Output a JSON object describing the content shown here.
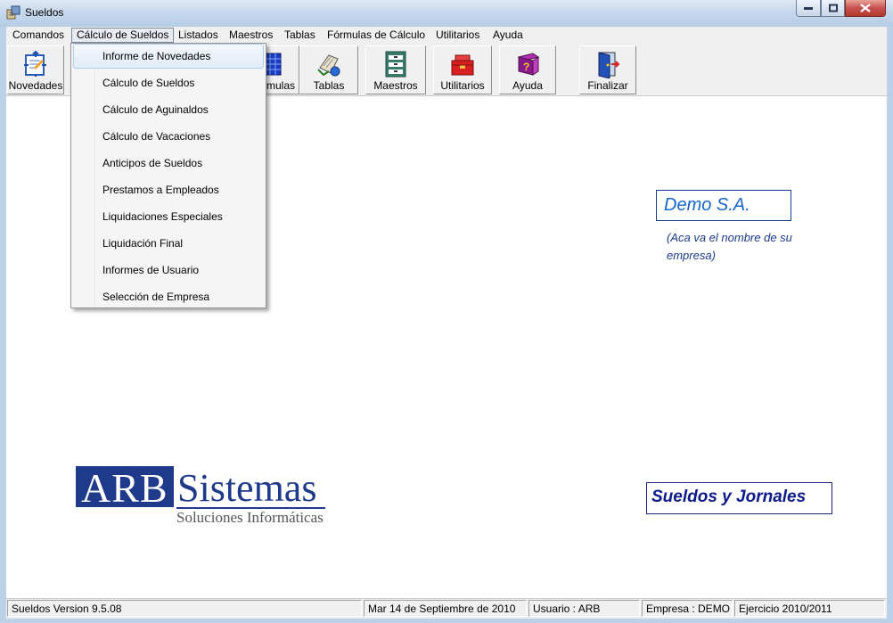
{
  "window": {
    "title": "Sueldos"
  },
  "menubar": {
    "items": [
      "Comandos",
      "Cálculo de Sueldos",
      "Listados",
      "Maestros",
      "Tablas",
      "Fórmulas de Cálculo",
      "Utilitarios",
      "Ayuda"
    ],
    "active": "Cálculo de Sueldos"
  },
  "toolbar": {
    "buttons": [
      {
        "label": "Novedades",
        "icon": "novedades-icon"
      },
      {
        "label": "mulas",
        "icon": "formulas-grid-icon"
      },
      {
        "label": "Tablas",
        "icon": "tablas-icon"
      },
      {
        "label": "Maestros",
        "icon": "maestros-icon"
      },
      {
        "label": "Utilitarios",
        "icon": "utilitarios-toolbox-icon"
      },
      {
        "label": "Ayuda",
        "icon": "ayuda-book-icon"
      },
      {
        "label": "Finalizar",
        "icon": "finalizar-door-icon"
      }
    ]
  },
  "dropdown": {
    "items": [
      "Informe de Novedades",
      "Cálculo de Sueldos",
      "Cálculo de Aguinaldos",
      "Cálculo de Vacaciones",
      "Anticipos de Sueldos",
      "Prestamos a Empleados",
      "Liquidaciones Especiales",
      "Liquidación Final",
      "Informes de Usuario",
      "Selección de Empresa"
    ],
    "highlighted": "Informe de Novedades"
  },
  "content": {
    "company_name": "Demo S.A.",
    "company_note": "(Aca va el nombre de su empresa)",
    "product_name": "Sueldos y Jornales",
    "logo": {
      "part1": "ARB",
      "part2": "Sistemas",
      "tagline": "Soluciones Informáticas"
    }
  },
  "statusbar": {
    "version": "Sueldos Version 9.5.08",
    "date": "Mar 14 de Septiembre de 2010",
    "usuario": "Usuario : ARB",
    "empresa": "Empresa : DEMO",
    "ejercicio": "Ejercicio 2010/2011"
  },
  "colors": {
    "accent": "#1f3a8a",
    "demo_text": "#1665c9",
    "titlebar": "#c6d8ec",
    "close_button": "#c75050"
  }
}
